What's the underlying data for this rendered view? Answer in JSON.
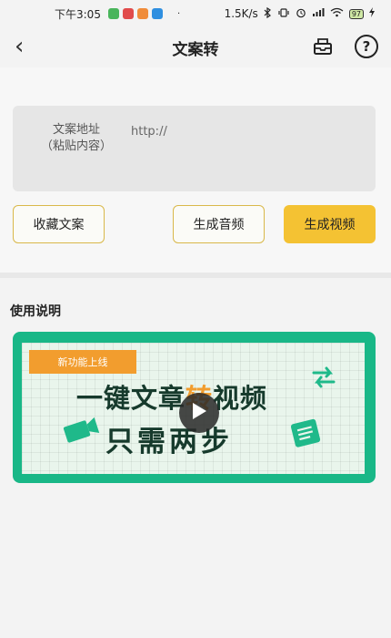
{
  "status_bar": {
    "time": "下午3:05",
    "dot": "·",
    "speed": "1.5K/s",
    "battery": "97"
  },
  "nav": {
    "back": "‹",
    "title": "文案转",
    "help": "?"
  },
  "input": {
    "label_line1": "文案地址",
    "label_line2": "（粘贴内容）",
    "placeholder": "http://"
  },
  "buttons": {
    "collect": "收藏文案",
    "audio": "生成音频",
    "video": "生成视频"
  },
  "usage": {
    "title": "使用说明"
  },
  "banner": {
    "tag": "新功能上线",
    "headline_pre": "一键文章",
    "headline_hl": "转",
    "headline_post": "视频",
    "subline": "只需两步"
  },
  "colors": {
    "accent": "#f4c233",
    "button_border": "#d9b84a",
    "banner_green": "#19b787",
    "tag_orange": "#f29d2e"
  },
  "icons": [
    "wechat-app-icon",
    "message-app-icon",
    "camera-app-icon",
    "browser-app-icon",
    "bluetooth-icon",
    "vibrate-icon",
    "alarm-icon",
    "signal-icon",
    "wifi-icon",
    "battery-icon",
    "charging-icon",
    "back-icon",
    "inbox-icon",
    "help-icon",
    "play-icon",
    "camera-icon",
    "arrows-icon",
    "document-icon"
  ]
}
